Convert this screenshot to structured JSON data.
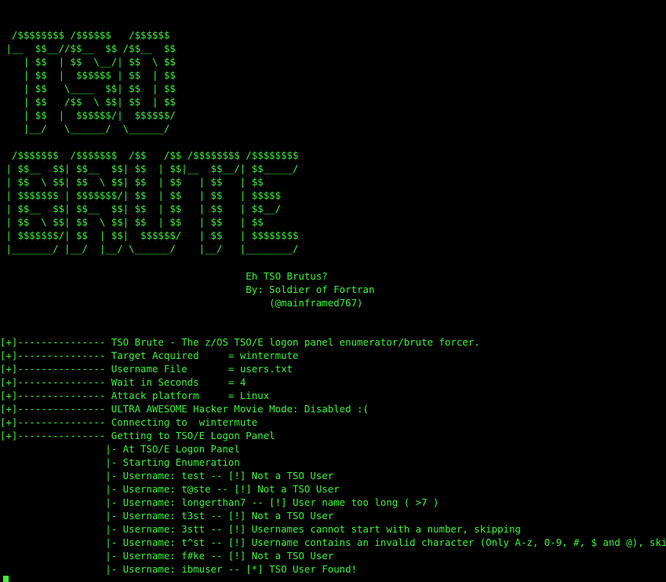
{
  "terminal": {
    "foreground": "#3cf03c",
    "background": "#000000",
    "logo_tso": [
      "  /$$$$$$$$ /$$$$$$   /$$$$$$",
      " |__  $$__//$$__  $$ /$$__  $$",
      "    | $$  | $$  \\__/| $$  \\ $$",
      "    | $$  |  $$$$$$ | $$  | $$",
      "    | $$   \\____  $$| $$  | $$",
      "    | $$   /$$  \\ $$| $$  | $$",
      "    | $$  |  $$$$$$/|  $$$$$$/",
      "    |__/   \\______/  \\______/"
    ],
    "logo_brute": [
      "  /$$$$$$$  /$$$$$$$  /$$   /$$ /$$$$$$$$ /$$$$$$$$",
      " | $$__  $$| $$__  $$| $$  | $$|__  $$__/| $$_____/",
      " | $$  \\ $$| $$  \\ $$| $$  | $$   | $$   | $$",
      " | $$$$$$$ | $$$$$$$/| $$  | $$   | $$   | $$$$$",
      " | $$__  $$| $$__  $$| $$  | $$   | $$   | $$__/",
      " | $$  \\ $$| $$  \\ $$| $$  | $$   | $$   | $$",
      " | $$$$$$$/| $$  | $$|  $$$$$$/   | $$   | $$$$$$$$",
      " |_______/ |__/  |__/ \\______/    |__/   |________/"
    ],
    "credits": [
      "                                          Eh TSO Brutus?",
      "                                          By: Soldier of Fortran",
      "                                              (@mainframed767)"
    ],
    "output": [
      "[+]--------------- TSO Brute - The z/OS TSO/E logon panel enumerator/brute forcer.",
      "[+]--------------- Target Acquired     = wintermute",
      "[+]--------------- Username File       = users.txt",
      "[+]--------------- Wait in Seconds     = 4",
      "[+]--------------- Attack platform     = Linux",
      "[+]--------------- ULTRA AWESOME Hacker Movie Mode: Disabled :(",
      "[+]--------------- Connecting to  wintermute",
      "[+]--------------- Getting to TSO/E Logon Panel",
      "                  |- At TSO/E Logon Panel",
      "                  |- Starting Enumeration",
      "                  |- Username: test -- [!] Not a TSO User",
      "                  |- Username: t@ste -- [!] Not a TSO User",
      "                  |- Username: longerthan7 -- [!] User name too long ( >7 )",
      "                  |- Username: t3st -- [!] Not a TSO User",
      "                  |- Username: 3stt -- [!] Usernames cannot start with a number, skipping",
      "                  |- Username: t^st -- [!] Username contains an invalid character (Only A-z, 0-9, #, $ and @), skipping",
      "                  |- Username: f#ke -- [!] Not a TSO User",
      "                  |- Username: ibmuser -- [*] TSO User Found!"
    ]
  }
}
